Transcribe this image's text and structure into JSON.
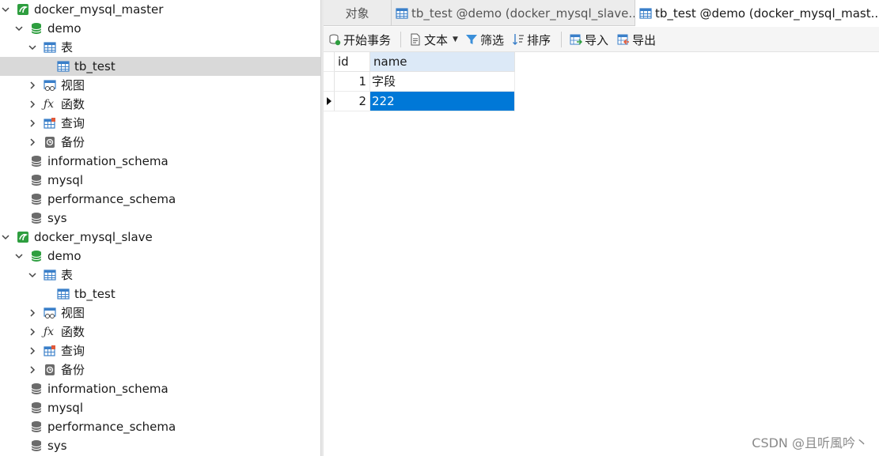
{
  "tree": {
    "conn1": {
      "label": "docker_mysql_master"
    },
    "conn1_db": {
      "label": "demo"
    },
    "conn1_tables": {
      "label": "表"
    },
    "conn1_table": {
      "label": "tb_test"
    },
    "conn1_views": {
      "label": "视图"
    },
    "conn1_funcs": {
      "label": "函数"
    },
    "conn1_queries": {
      "label": "查询"
    },
    "conn1_backups": {
      "label": "备份"
    },
    "conn1_db2": {
      "label": "information_schema"
    },
    "conn1_db3": {
      "label": "mysql"
    },
    "conn1_db4": {
      "label": "performance_schema"
    },
    "conn1_db5": {
      "label": "sys"
    },
    "conn2": {
      "label": "docker_mysql_slave"
    },
    "conn2_db": {
      "label": "demo"
    },
    "conn2_tables": {
      "label": "表"
    },
    "conn2_table": {
      "label": "tb_test"
    },
    "conn2_views": {
      "label": "视图"
    },
    "conn2_funcs": {
      "label": "函数"
    },
    "conn2_queries": {
      "label": "查询"
    },
    "conn2_backups": {
      "label": "备份"
    },
    "conn2_db2": {
      "label": "information_schema"
    },
    "conn2_db3": {
      "label": "mysql"
    },
    "conn2_db4": {
      "label": "performance_schema"
    },
    "conn2_db5": {
      "label": "sys"
    }
  },
  "tabs": {
    "objects": "对象",
    "tab1": "tb_test @demo (docker_mysql_slave...",
    "tab2": "tb_test @demo (docker_mysql_mast..."
  },
  "toolbar": {
    "begin_transaction": "开始事务",
    "text": "文本",
    "filter": "筛选",
    "sort": "排序",
    "import": "导入",
    "export": "导出"
  },
  "grid": {
    "columns": [
      "id",
      "name"
    ],
    "rows": [
      {
        "id": "1",
        "name": "字段"
      },
      {
        "id": "2",
        "name": "222"
      }
    ]
  },
  "watermark": "CSDN @且听風吟丶",
  "colors": {
    "accent_selection": "#0078d7",
    "column_header_highlight": "#dce9f7",
    "tree_selected": "#d9d9d9",
    "connection_icon": "#2e9e3f",
    "database_icon": "#2e9e3f"
  }
}
